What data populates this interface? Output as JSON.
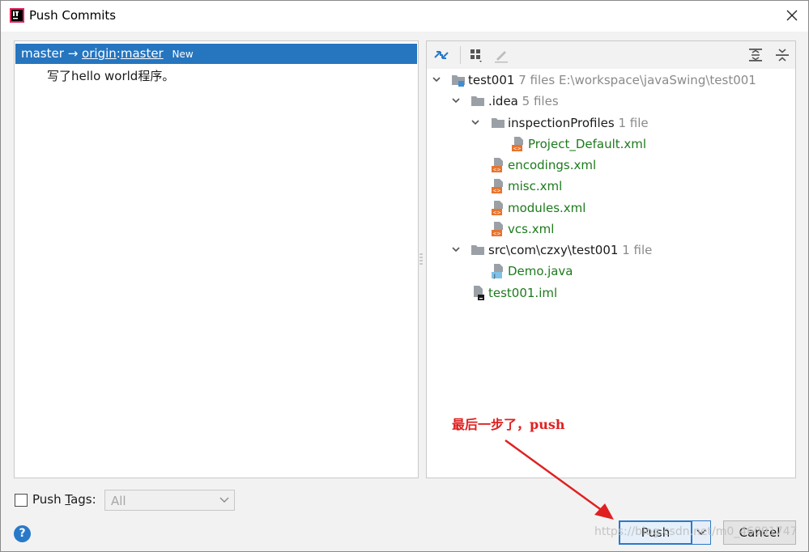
{
  "window": {
    "title": "Push Commits",
    "app_icon": "intellij-icon",
    "close_icon": "close-icon"
  },
  "left": {
    "branch": {
      "local": "master",
      "arrow": "→",
      "remote": "origin",
      "sep": ":",
      "remote_branch": "master",
      "badge": "New"
    },
    "commit": "写了hello world程序。"
  },
  "toolbar": {
    "icons": [
      "expand-changes-icon",
      "group-by-icon",
      "edit-icon",
      "expand-all-icon",
      "collapse-all-icon"
    ]
  },
  "tree": {
    "root": {
      "name": "test001",
      "count": "7 files",
      "path": "E:\\workspace\\javaSwing\\test001"
    },
    "idea": {
      "name": ".idea",
      "count": "5 files"
    },
    "inspection": {
      "name": "inspectionProfiles",
      "count": "1 file"
    },
    "files": {
      "project_default": "Project_Default.xml",
      "encodings": "encodings.xml",
      "misc": "misc.xml",
      "modules": "modules.xml",
      "vcs": "vcs.xml",
      "demo": "Demo.java",
      "iml": "test001.iml"
    },
    "src": {
      "name": "src\\com\\czxy\\test001",
      "count": "1 file"
    }
  },
  "bottom": {
    "push_tags_pre": "Push ",
    "push_tags_u": "T",
    "push_tags_post": "ags:",
    "tags_select": "All",
    "help": "?",
    "push": "Push",
    "cancel": "Cancel"
  },
  "annotation": "最后一步了，push",
  "watermark": "https://blog.csdn.net/m0_46091747",
  "colors": {
    "accent": "#2675bf",
    "added_file": "#1d7a1d",
    "annotation": "#e02020"
  }
}
